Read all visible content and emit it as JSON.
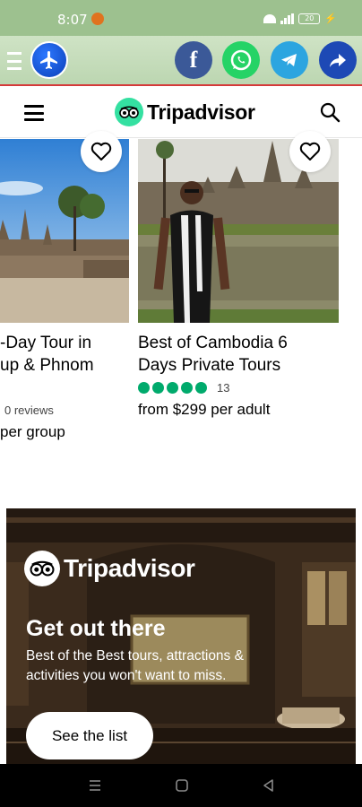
{
  "status_bar": {
    "time": "8:07",
    "battery": "20"
  },
  "header": {
    "logo_text": "Tripadvisor"
  },
  "cards": [
    {
      "title_line1": "-Day Tour in",
      "title_line2": "up & Phnom",
      "reviews": "0 reviews",
      "price": "per group"
    },
    {
      "title_line1": "Best of Cambodia 6",
      "title_line2": "Days Private Tours",
      "rating_value": 5,
      "rating_count": "13",
      "price": "from $299 per adult"
    }
  ],
  "promo": {
    "logo_text": "Tripadvisor",
    "headline": "Get out there",
    "subtitle": "Best of the Best tours, attractions & activities you won't want to miss.",
    "button_label": "See the list"
  },
  "colors": {
    "status_bar": "#9dc18f",
    "share_bar": "#c8dfbd",
    "accent_line": "#d43a3a",
    "brand_green": "#34e0a1",
    "rating_green": "#00aa6c"
  }
}
